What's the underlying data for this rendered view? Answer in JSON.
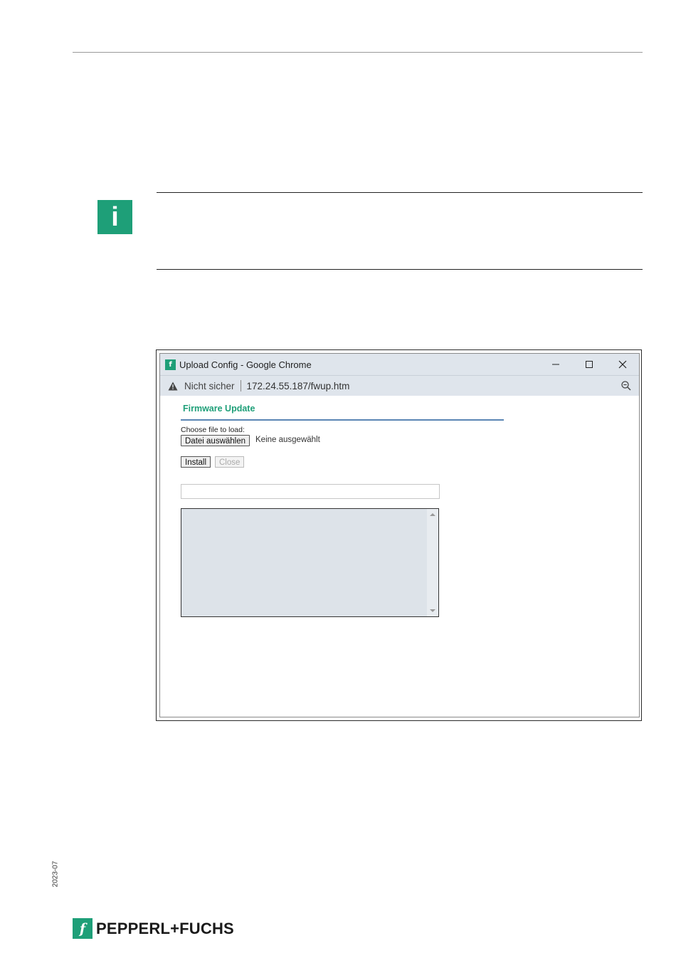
{
  "info_icon": {
    "glyph": "i",
    "color": "#1e9f78"
  },
  "screenshot": {
    "window": {
      "title": "Upload Config - Google Chrome",
      "app_icon_glyph": "f",
      "controls": {
        "minimize": "—",
        "maximize": "☐",
        "close": "✕"
      }
    },
    "addressbar": {
      "security_text": "Nicht sicher",
      "url": "172.24.55.187/fwup.htm"
    },
    "page": {
      "heading": "Firmware Update",
      "choose_label": "Choose file to load:",
      "file_button": "Datei auswählen",
      "file_status": "Keine ausgewählt",
      "install_button": "Install",
      "close_button": "Close",
      "progress_value": "",
      "log_text": ""
    }
  },
  "footer": {
    "date_code": "2023-07",
    "brand": "PEPPERL+FUCHS",
    "brand_mark": "f",
    "brand_color": "#1e9f78"
  }
}
